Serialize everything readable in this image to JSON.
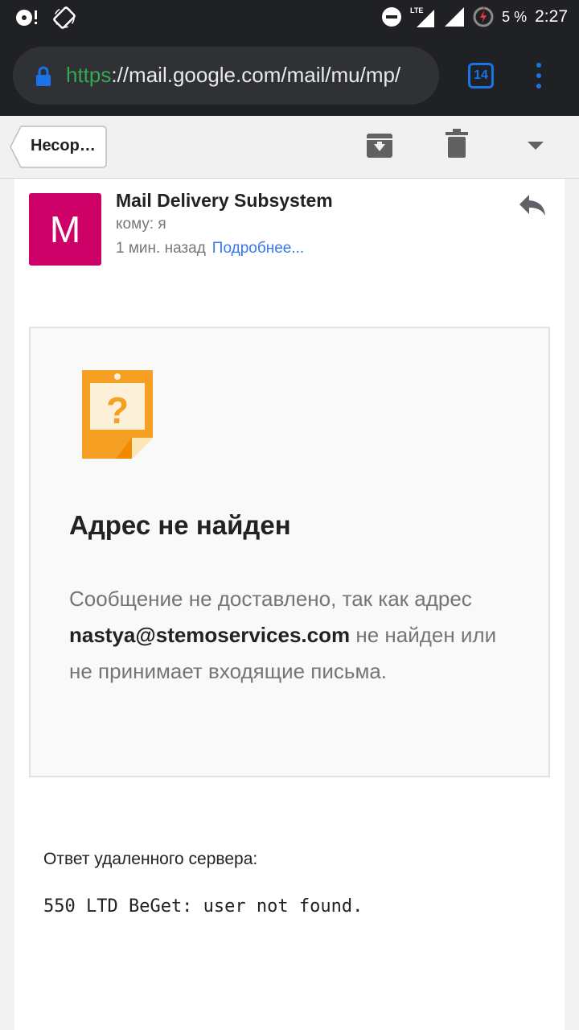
{
  "status_bar": {
    "battery_text": "5 %",
    "time": "2:27",
    "network": "LTE"
  },
  "browser": {
    "url_scheme": "https",
    "url_rest": "://mail.google.com/mail/mu/mp/",
    "tab_count": "14",
    "accent_color": "#1a73e8"
  },
  "toolbar": {
    "back_label": "Несор…",
    "icons": [
      "archive-icon",
      "trash-icon",
      "dropdown-icon"
    ]
  },
  "message": {
    "avatar_letter": "M",
    "avatar_color": "#cc0066",
    "sender": "Mail Delivery Subsystem",
    "to": "кому: я",
    "time": "1 мин. назад",
    "details_link": "Подробнее..."
  },
  "bounce": {
    "title": "Адрес не найден",
    "text_before": "Сообщение не доставлено, так как адрес ",
    "address": "nastya@stemoservices.com",
    "text_after": " не найден или не принимает входящие письма.",
    "icon_color": "#f5a023"
  },
  "remote": {
    "label": "Ответ удаленного сервера:",
    "response": "550 LTD BeGet: user not found."
  }
}
